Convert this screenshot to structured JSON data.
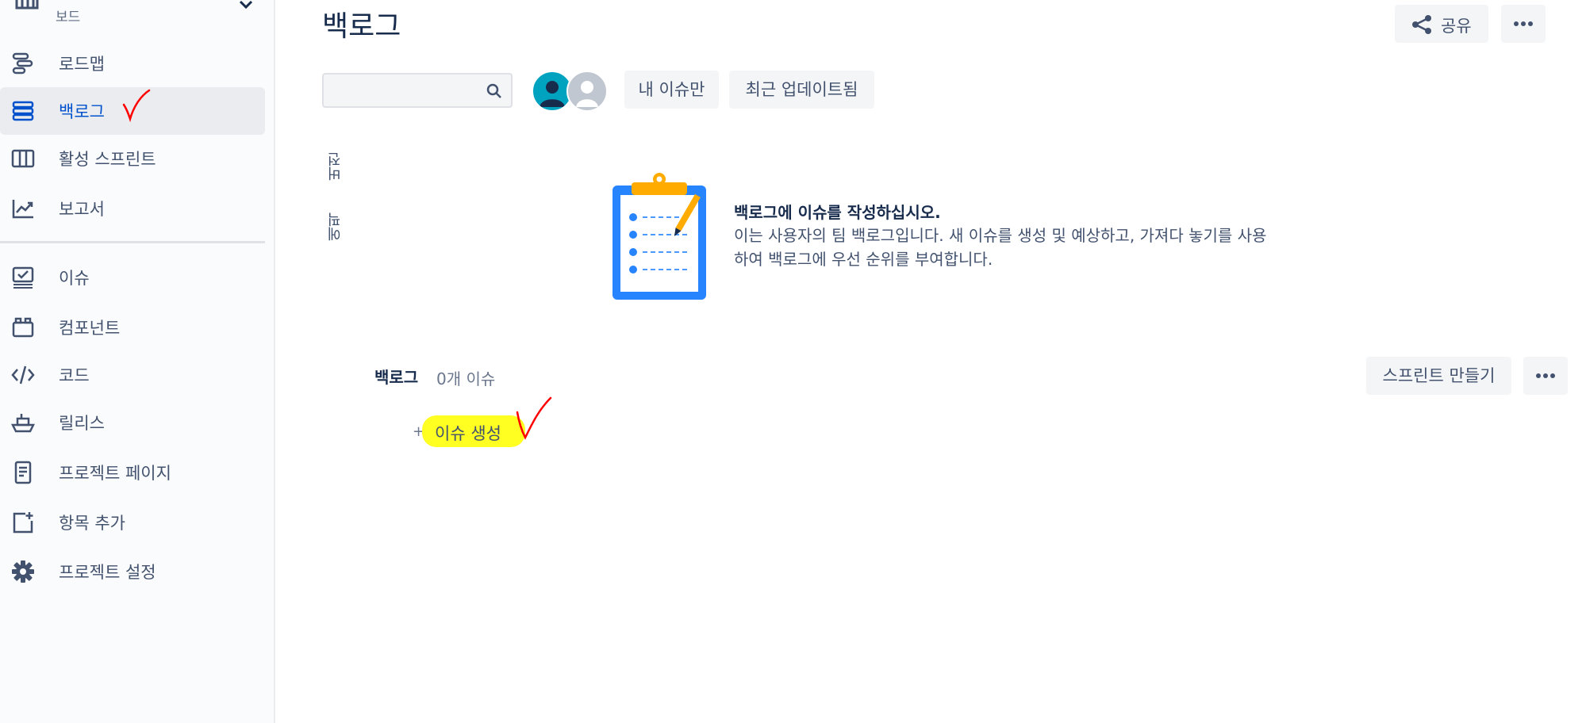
{
  "sidebar": {
    "board_label": "보드",
    "items": [
      {
        "label": "로드맵",
        "icon": "roadmap-icon"
      },
      {
        "label": "백로그",
        "icon": "backlog-icon",
        "active": true
      },
      {
        "label": "활성 스프린트",
        "icon": "sprint-board-icon"
      },
      {
        "label": "보고서",
        "icon": "reports-icon"
      },
      {
        "label": "이슈",
        "icon": "issues-icon"
      },
      {
        "label": "컴포넌트",
        "icon": "components-icon"
      },
      {
        "label": "코드",
        "icon": "code-icon"
      },
      {
        "label": "릴리스",
        "icon": "releases-icon"
      },
      {
        "label": "프로젝트 페이지",
        "icon": "project-pages-icon"
      },
      {
        "label": "항목 추가",
        "icon": "add-item-icon"
      },
      {
        "label": "프로젝트 설정",
        "icon": "settings-gear-icon"
      }
    ]
  },
  "header": {
    "title": "백로그",
    "share_label": "공유"
  },
  "toolbar": {
    "search_placeholder": "",
    "search_value": "",
    "filter_mine": "내 이슈만",
    "filter_recent": "최근 업데이트됨"
  },
  "side_panel": {
    "versions_label": "버전",
    "epics_label": "에픽"
  },
  "empty_state": {
    "heading": "백로그에 이슈를 작성하십시오.",
    "description_line1": "이는 사용자의 팀 백로그입니다. 새 이슈를 생성 및 예상하고, 가져다 놓기를 사용",
    "description_line2": "하여 백로그에 우선 순위를 부여합니다."
  },
  "backlog": {
    "title": "백로그",
    "count": "0개 이슈",
    "create_sprint_label": "스프린트 만들기",
    "create_issue_plus": "+",
    "create_issue_label": "이슈 생성"
  },
  "colors": {
    "accent_blue": "#0052cc",
    "active_bg": "#ebecf0",
    "highlight_yellow": "#ffff22",
    "annotation_red": "#ff0000"
  }
}
